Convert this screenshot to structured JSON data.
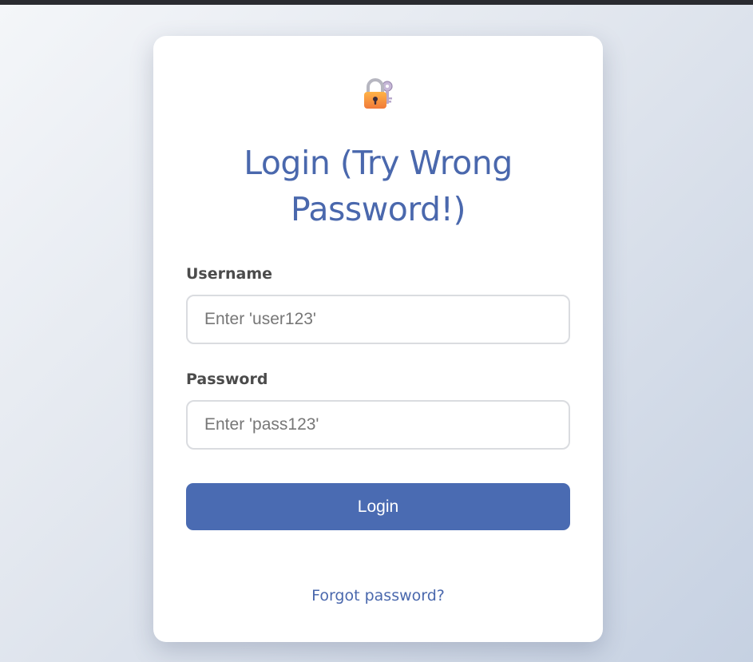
{
  "header": {
    "icon": "lock-with-key-icon"
  },
  "title": "Login (Try Wrong Password!)",
  "form": {
    "username": {
      "label": "Username",
      "value": "",
      "placeholder": "Enter 'user123'"
    },
    "password": {
      "label": "Password",
      "value": "",
      "placeholder": "Enter 'pass123'"
    },
    "submit_label": "Login"
  },
  "forgot_link": "Forgot password?",
  "colors": {
    "accent": "#4a6bb2",
    "title": "#4a68ad",
    "label": "#4b4b4b",
    "card_background": "#ffffff",
    "top_bar": "#2a2b30"
  }
}
